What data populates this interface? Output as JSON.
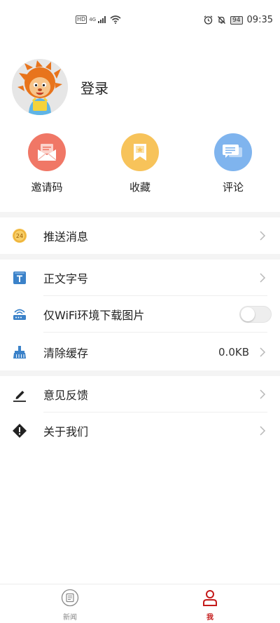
{
  "status_bar": {
    "network": "HD",
    "signal_label": "4G",
    "battery": "94",
    "time": "09:35"
  },
  "profile": {
    "login_label": "登录"
  },
  "quick_actions": [
    {
      "label": "邀请码",
      "icon": "envelope-icon",
      "color": "#f07766"
    },
    {
      "label": "收藏",
      "icon": "bookmark-icon",
      "color": "#f7c35a"
    },
    {
      "label": "评论",
      "icon": "chat-icon",
      "color": "#7fb4ee"
    }
  ],
  "menu": {
    "push": {
      "label": "推送消息",
      "badge": "24"
    },
    "font_size": {
      "label": "正文字号"
    },
    "wifi_images": {
      "label": "仅WiFi环境下载图片",
      "enabled": false
    },
    "clear_cache": {
      "label": "清除缓存",
      "value": "0.0KB"
    },
    "feedback": {
      "label": "意见反馈"
    },
    "about": {
      "label": "关于我们"
    }
  },
  "bottom_nav": [
    {
      "label": "新闻",
      "icon": "news-icon",
      "active": false
    },
    {
      "label": "我",
      "icon": "person-icon",
      "active": true
    }
  ],
  "colors": {
    "accent_active": "#c41a1a",
    "nav_inactive": "#888888"
  }
}
